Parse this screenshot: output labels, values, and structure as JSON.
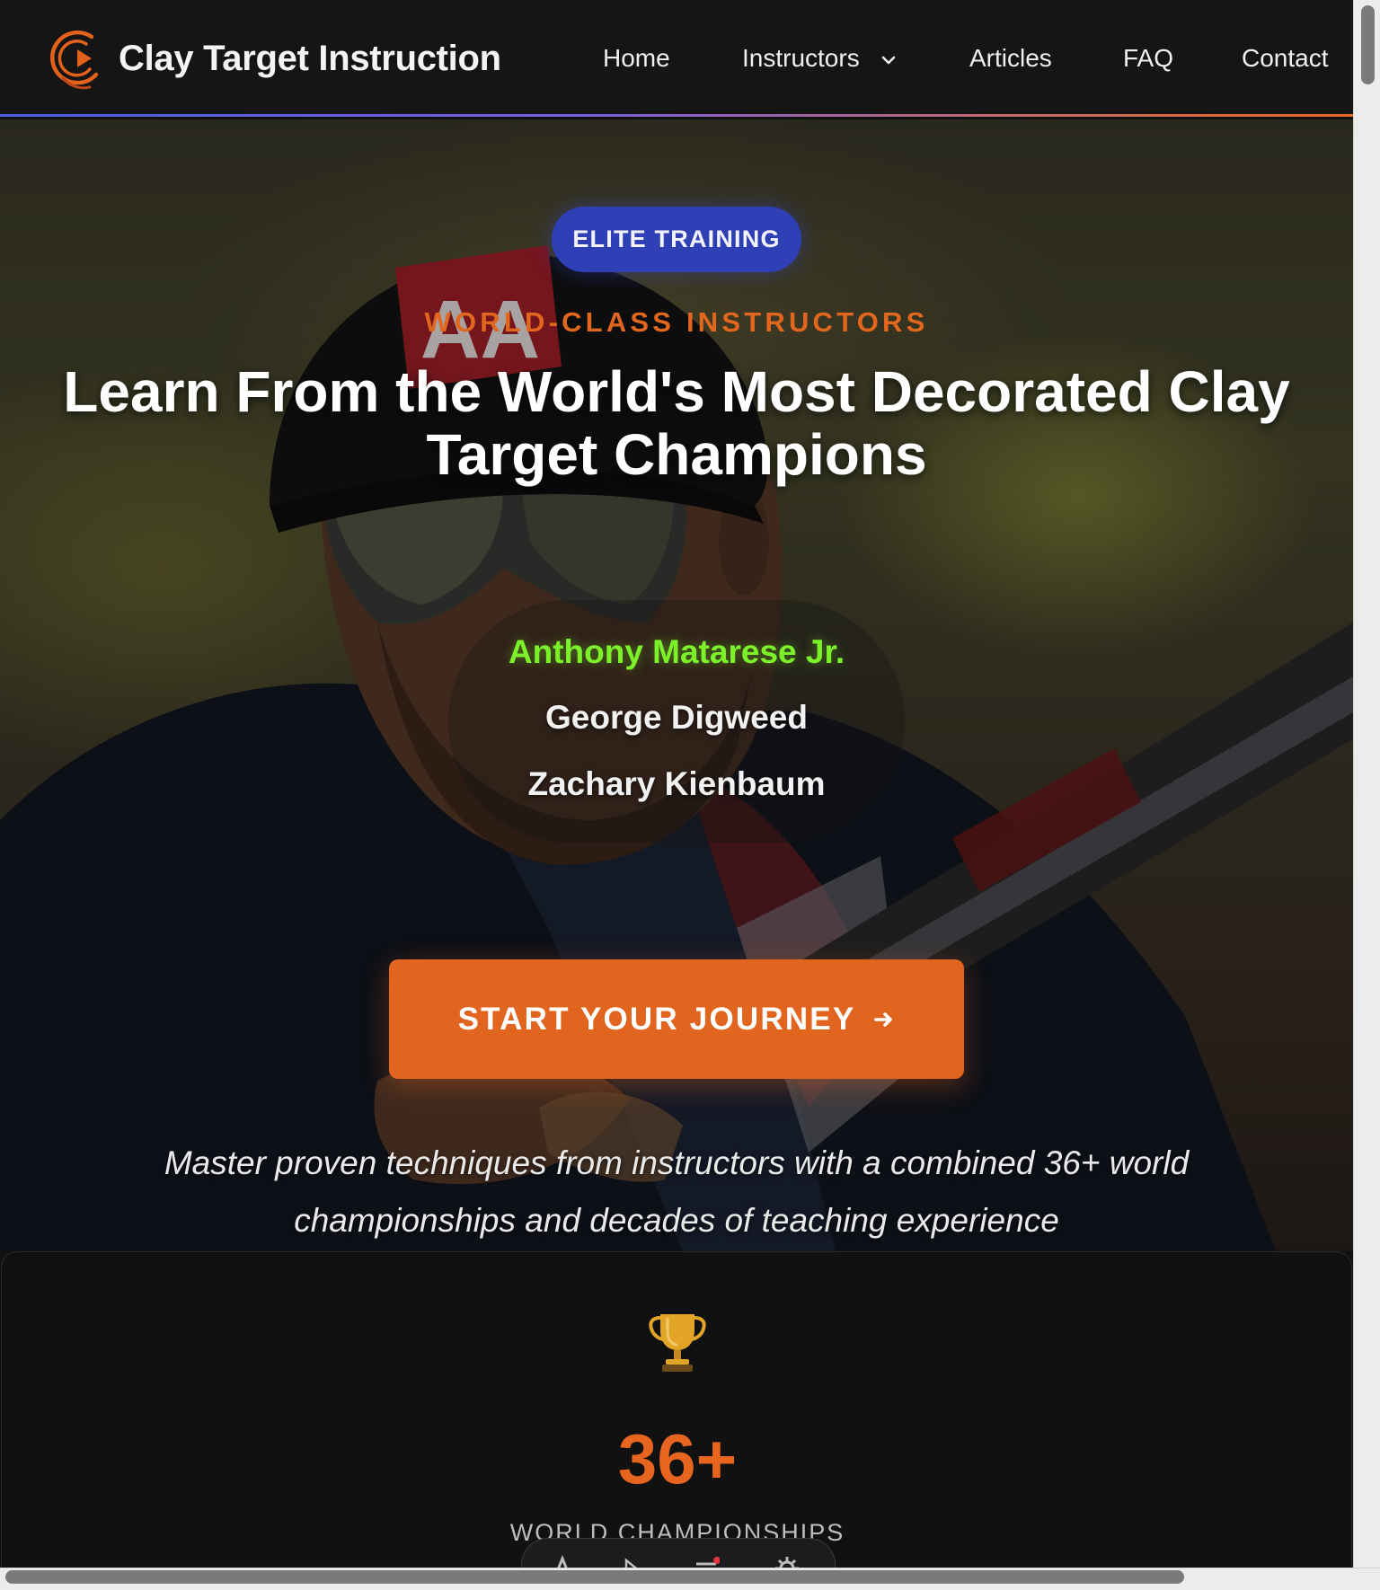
{
  "header": {
    "brand_title": "Clay Target Instruction",
    "logo_icon": "play-circle-logo-icon",
    "nav": [
      {
        "label": "Home"
      },
      {
        "label": "Instructors",
        "has_dropdown": true
      },
      {
        "label": "Articles"
      },
      {
        "label": "FAQ"
      },
      {
        "label": "Contact"
      }
    ]
  },
  "hero": {
    "badge": "ELITE TRAINING",
    "eyebrow": "WORLD-CLASS INSTRUCTORS",
    "headline": "Learn From the World's Most Decorated Clay Target Champions",
    "instructors": [
      "Anthony Matarese Jr.",
      "George Digweed",
      "Zachary Kienbaum"
    ],
    "active_instructor_index": 0,
    "cta_label": "START YOUR JOURNEY",
    "tagline": "Master proven techniques from instructors with a combined 36+ world championships and decades of teaching experience",
    "photo_cap_text": "AA"
  },
  "stats": {
    "icon": "trophy-icon",
    "value": "36+",
    "label": "WORLD CHAMPIONSHIPS"
  },
  "colors": {
    "accent": "#e1641f",
    "badge": "#2f3fb5",
    "active_name": "#7cf12a",
    "header_bg": "#151516",
    "page_bg": "#111112"
  }
}
